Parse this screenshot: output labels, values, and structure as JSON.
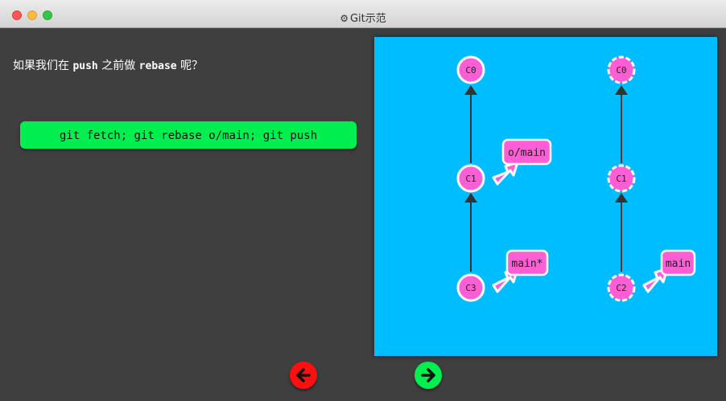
{
  "window": {
    "title": "Git示范",
    "icon": "gear-icon"
  },
  "dialog": {
    "text_before_push": "如果我们在 ",
    "code_push": "push",
    "text_middle": " 之前做 ",
    "code_rebase": "rebase",
    "text_after": " 呢？"
  },
  "command": {
    "label": "git fetch; git rebase o/main; git push"
  },
  "nav": {
    "back_icon": "arrow-left-icon",
    "forward_icon": "arrow-right-icon"
  },
  "colors": {
    "canvas": "#00bdff",
    "commit": "#ff5ed4",
    "command_button": "#00ee50",
    "back_button": "#ff1010",
    "forward_button": "#00ee50"
  },
  "graph": {
    "local": {
      "commits": [
        "C0",
        "C1",
        "C3"
      ],
      "labels": [
        "o/main",
        "main*"
      ]
    },
    "remote": {
      "commits": [
        "C0",
        "C1",
        "C2"
      ],
      "labels": [
        "main"
      ]
    }
  }
}
